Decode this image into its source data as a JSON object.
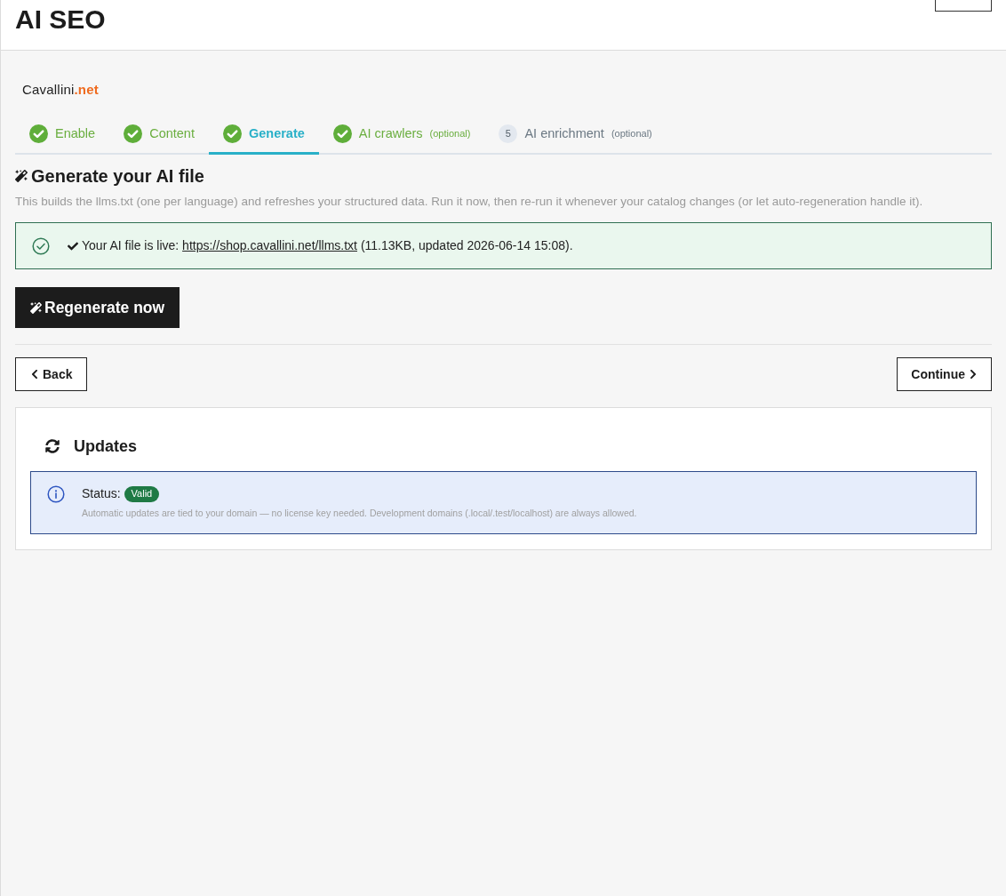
{
  "header": {
    "title": "AI SEO"
  },
  "logo": {
    "name": "Cavallini",
    "suffix": ".net"
  },
  "steps": [
    {
      "label": "Enable",
      "selected": false,
      "completed": true
    },
    {
      "label": "Content",
      "selected": false,
      "completed": true
    },
    {
      "label": "Generate",
      "selected": true,
      "completed": true
    },
    {
      "label": "AI crawlers",
      "note": "(optional)",
      "selected": false,
      "completed": true
    },
    {
      "label": "AI enrichment",
      "note": "(optional)",
      "number": "5",
      "selected": false,
      "completed": false
    }
  ],
  "section": {
    "title": "Generate your AI file",
    "description": "This builds the llms.txt (one per language) and refreshes your structured data. Run it now, then re-run it whenever your catalog changes (or let auto-regeneration handle it)."
  },
  "notice": {
    "kind": "success",
    "prefix": "Your AI file is live:",
    "link": "https://shop.cavallini.net/llms.txt",
    "suffix": "(11.13KB, updated 2026-06-14 15:08)."
  },
  "primary_button": {
    "label": "Regenerate now"
  },
  "navigation": {
    "back": "Back",
    "continue": "Continue"
  },
  "updates": {
    "title": "Updates",
    "status_label": "Status:",
    "status": {
      "label": "Valid",
      "kind": "valid"
    },
    "note": "Automatic updates are tied to your domain — no license key needed. Development domains (.local/.test/localhost) are always allowed."
  }
}
